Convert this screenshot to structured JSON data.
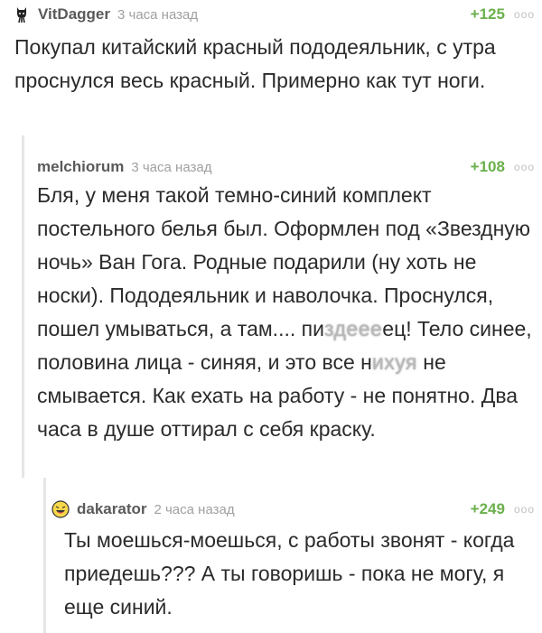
{
  "comments": [
    {
      "author": "VitDagger",
      "time": "3 часа назад",
      "rating": "+125",
      "more": "ooo",
      "avatar_icon": "cat-avatar-icon",
      "text": "Покупал китайский красный пододеяльник, с утра проснулся весь красный. Примерно как тут ноги."
    },
    {
      "author": "melchiorum",
      "time": "3 часа назад",
      "rating": "+108",
      "more": "ooo",
      "text_a": "Бля, у меня такой темно-синий комплект постельного белья был. Оформлен под «Звездную ночь» Ван Гога. Родные подарили (ну хоть не носки). Пододеяльник и наволочка. Проснулся, пошел умываться, а там.... пи",
      "text_blur1": "здеее",
      "text_b": "ец! Тело синее, половина лица - синяя, и это все н",
      "text_blur2": "ихуя",
      "text_c": " не смывается. Как ехать на работу - не понятно. Два часа в душе оттирал с себя краску."
    },
    {
      "author": "dakarator",
      "time": "2 часа назад",
      "rating": "+249",
      "more": "ooo",
      "avatar_icon": "laughing-smiley-avatar-icon",
      "text": "Ты моешься-моешься, с работы звонят - когда приедешь??? А ты говоришь - пока не могу, я еще синий."
    }
  ],
  "colors": {
    "rating": "#6ab04c",
    "author": "#5a5a5a",
    "time": "#a0a0a0",
    "thread_line": "#e6e6e6"
  }
}
